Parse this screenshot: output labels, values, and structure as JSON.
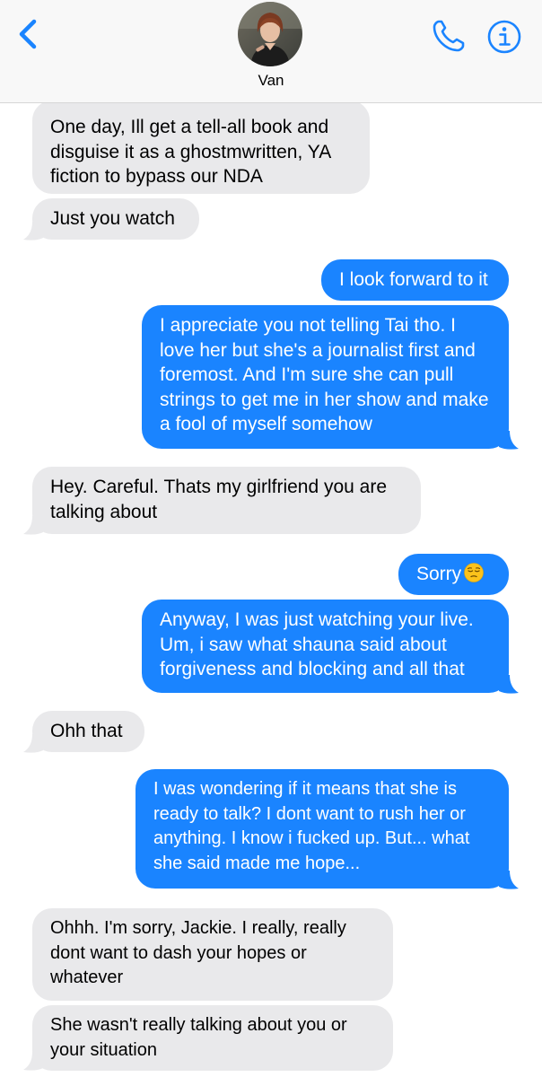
{
  "header": {
    "contact_name": "Van",
    "back_icon": "chevron-left-icon",
    "call_icon": "phone-icon",
    "info_icon": "info-icon"
  },
  "colors": {
    "sent_bubble": "#1a84ff",
    "received_bubble": "#e9e9eb",
    "accent": "#1a84ff"
  },
  "messages": [
    {
      "from": "contact",
      "text": "One day, Ill get a tell-all book and disguise it as a ghostmwritten, YA fiction to bypass our NDA"
    },
    {
      "from": "contact",
      "text": "Just you watch"
    },
    {
      "from": "me",
      "text": "I look forward to it"
    },
    {
      "from": "me",
      "text": "I appreciate you not telling Tai tho. I love her but she's a journalist first and foremost. And I'm sure she can pull strings to get me in her show and make a fool of myself somehow"
    },
    {
      "from": "contact",
      "text": "Hey. Careful. Thats my girlfriend you are talking about"
    },
    {
      "from": "me",
      "text": "Sorry",
      "emoji": "pensive-face-emoji"
    },
    {
      "from": "me",
      "text": "Anyway, I was just watching your live. Um, i saw what shauna said about forgiveness and blocking and all that"
    },
    {
      "from": "contact",
      "text": "Ohh that"
    },
    {
      "from": "me",
      "text": "I was wondering if it means that she is ready to talk? I dont want to rush her or anything. I know i fucked up. But... what she said made me hope..."
    },
    {
      "from": "contact",
      "text": "Ohhh. I'm sorry, Jackie. I really, really dont want to dash your hopes or whatever"
    },
    {
      "from": "contact",
      "text": "She wasn't really talking about you or your situation"
    }
  ]
}
